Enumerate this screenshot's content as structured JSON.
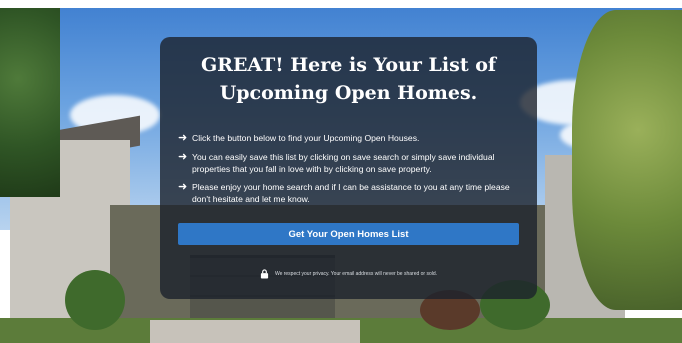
{
  "card": {
    "headline_line1": "GREAT! Here is Your List of",
    "headline_line2": "Upcoming Open Homes.",
    "bullets": [
      "Click the button below to find your Upcoming Open Houses.",
      "You can easily save this list by clicking on save search or simply save individual properties that you fall in love with by clicking on save property.",
      "Please enjoy your home search and if I can be assistance to you at any time please don't hesitate and let me know."
    ],
    "cta_label": "Get Your Open Homes List",
    "privacy_text": "We respect your privacy. Your email address will never be shared or sold."
  },
  "icons": {
    "bullet": "arrow-right-icon",
    "privacy": "lock-icon"
  },
  "colors": {
    "overlay": "#1c222c",
    "cta": "#2f77c6",
    "text": "#ffffff"
  }
}
